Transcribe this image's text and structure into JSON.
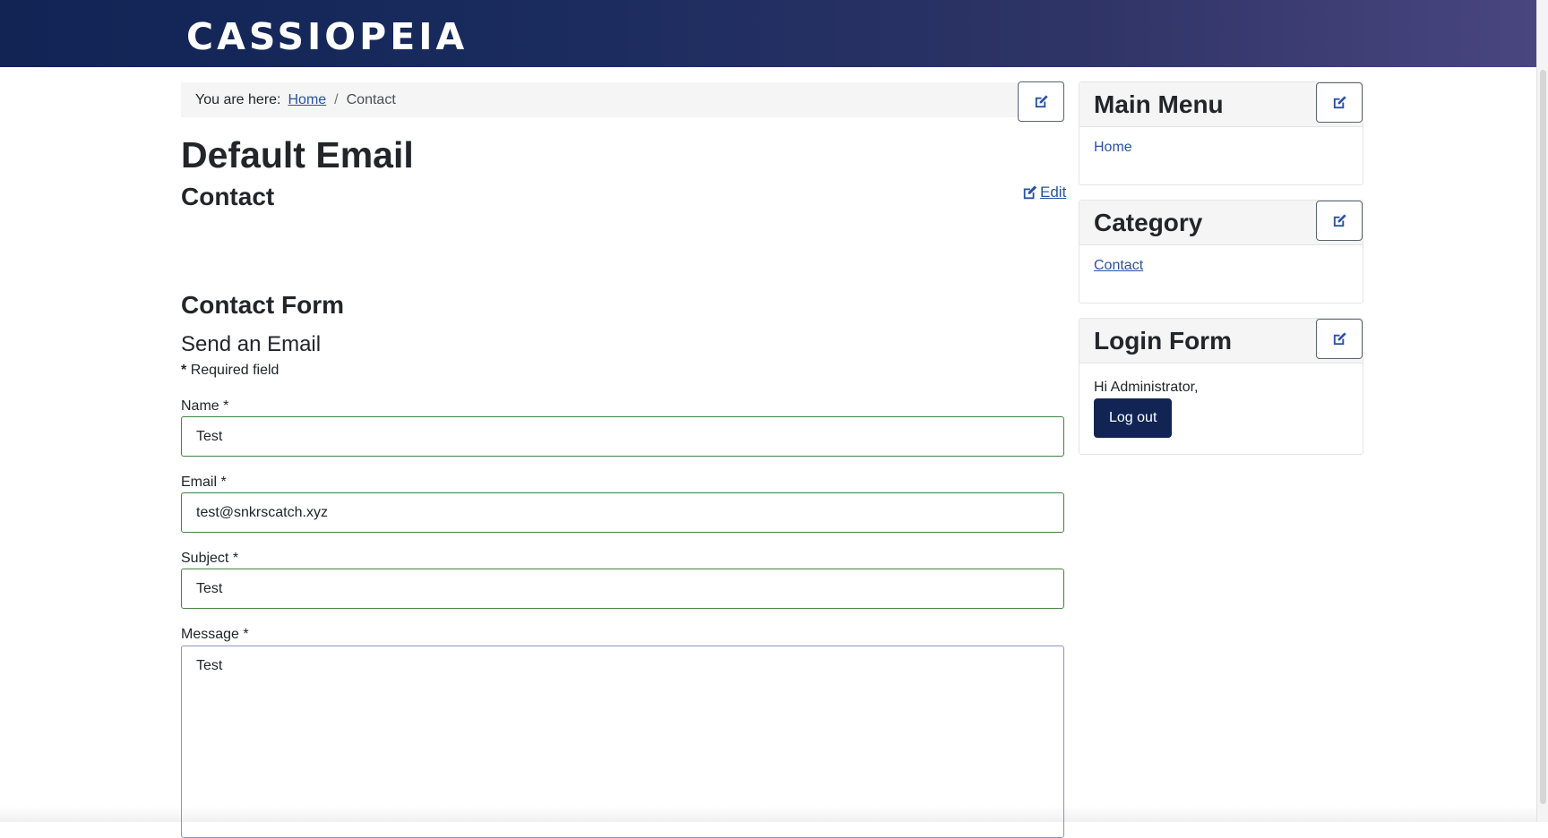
{
  "header": {
    "brand": "CASSIOPEIA"
  },
  "breadcrumb": {
    "prefix": "You are here:",
    "home": "Home",
    "separator": "/",
    "current": "Contact"
  },
  "icons": {
    "edit": "edit-pencil-icon"
  },
  "main": {
    "title": "Default Email",
    "contact_heading": "Contact",
    "edit_link": "Edit",
    "form_heading": "Contact Form",
    "send_heading": "Send an Email",
    "required_star": "*",
    "required_text": "Required field",
    "fields": {
      "name": {
        "label": "Name *",
        "value": "Test"
      },
      "email": {
        "label": "Email *",
        "value": "test@snkrscatch.xyz"
      },
      "subject": {
        "label": "Subject *",
        "value": "Test"
      },
      "message": {
        "label": "Message *",
        "value": "Test"
      }
    }
  },
  "sidebar": {
    "main_menu": {
      "title": "Main Menu",
      "items": [
        "Home"
      ]
    },
    "category": {
      "title": "Category",
      "items": [
        "Contact"
      ]
    },
    "login": {
      "title": "Login Form",
      "greeting": "Hi Administrator,",
      "logout_label": "Log out"
    }
  },
  "colors": {
    "header_dark": "#112454",
    "link": "#2a53a4",
    "valid_border": "#448344",
    "button_bg": "#112454"
  }
}
